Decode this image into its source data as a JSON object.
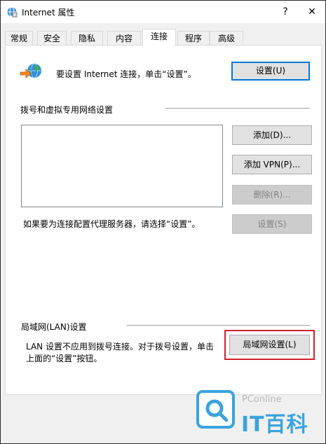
{
  "window": {
    "title": "Internet 属性",
    "help_glyph": "?",
    "close_glyph": "✕"
  },
  "tabs": [
    {
      "label": "常规"
    },
    {
      "label": "安全"
    },
    {
      "label": "隐私"
    },
    {
      "label": "内容"
    },
    {
      "label": "连接",
      "active": true
    },
    {
      "label": "程序"
    },
    {
      "label": "高级"
    }
  ],
  "connection": {
    "setup_text": "要设置 Internet 连接，单击“设置”。",
    "setup_button": "设置(U)"
  },
  "dialup": {
    "section_label": "拨号和虚拟专用网络设置",
    "add_button": "添加(D)...",
    "add_vpn_button": "添加 VPN(P)...",
    "delete_button": "删除(R)...",
    "proxy_text": "如果要为连接配置代理服务器，请选择“设置”。",
    "settings_button": "设置(S)"
  },
  "lan": {
    "section_label": "局域网(LAN)设置",
    "desc_line1": "LAN 设置不应用到拨号连接。对于拨号设置，单击",
    "desc_line2": "上面的“设置”按钮。",
    "lan_button": "局域网设置(L)"
  },
  "watermark": {
    "brand": "PConline",
    "text": "IT百科"
  },
  "colors": {
    "accent": "#0078d7",
    "highlight": "#d0212b",
    "watermark": "#3aa3de"
  },
  "icons": {
    "title": "internet-options-icon",
    "connection": "globe-network-icon"
  }
}
